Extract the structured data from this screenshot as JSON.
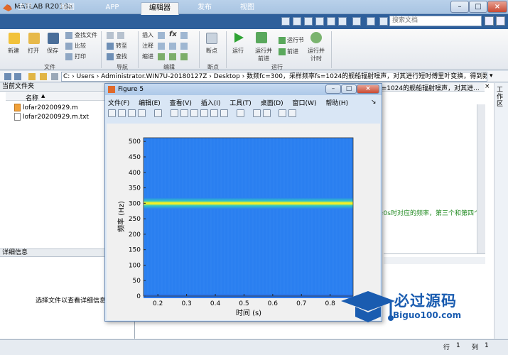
{
  "window": {
    "title": "MATLAB R2018a",
    "min": "–",
    "max": "□",
    "close": "×"
  },
  "tabs": [
    {
      "label": "主页"
    },
    {
      "label": "绘图"
    },
    {
      "label": "APP"
    },
    {
      "label": "编辑器"
    },
    {
      "label": "发布"
    },
    {
      "label": "视图"
    }
  ],
  "search": {
    "placeholder": "搜索文档"
  },
  "ribbon": {
    "file": {
      "new": "新建",
      "open": "打开",
      "save": "保存",
      "find_files": "查找文件",
      "compare": "比较",
      "print": "打印",
      "group": "文件"
    },
    "nav": {
      "goto": "转至",
      "find": "查找",
      "group": "导航"
    },
    "edit": {
      "insert": "插入",
      "comment": "注释",
      "indent": "缩进",
      "fx": "fx",
      "group": "编辑"
    },
    "breakpoints": {
      "label": "断点",
      "group": "断点"
    },
    "run": {
      "run": "运行",
      "run_advance": "运行并前进",
      "run_section": "运行节",
      "advance": "前进",
      "run_time": "运行并计时",
      "group": "运行"
    }
  },
  "address": {
    "path": "C: › Users › Administrator.WIN7U-20180127Z › Desktop › 数频fc=300，采样频率fs=1024的舰船辐射噪声，对其进行短时傅里叶变换，得到数频"
  },
  "current_folder": {
    "title": "当前文件夹",
    "col_name": "名称",
    "sort": "▲",
    "files": [
      "lofar20200929.m",
      "lofar20200929.m.txt"
    ]
  },
  "details": {
    "title": "详细信息",
    "empty": "选择文件以查看详细信息"
  },
  "editor": {
    "tab_text": "s=1024的舰船辐射噪声，对其进...",
    "code_line": "=0s时对应的频率，第三个和第四个"
  },
  "workspace": {
    "label": "工作区"
  },
  "figure": {
    "title": "Figure 5",
    "menu": [
      "文件(F)",
      "编辑(E)",
      "查看(V)",
      "插入(I)",
      "工具(T)",
      "桌面(D)",
      "窗口(W)",
      "帮助(H)"
    ]
  },
  "chart_data": {
    "type": "heatmap",
    "xlabel": "时间 (s)",
    "ylabel": "频率 (Hz)",
    "xticks": [
      "0.2",
      "0.3",
      "0.4",
      "0.5",
      "0.6",
      "0.7",
      "0.8"
    ],
    "yticks": [
      "0",
      "50",
      "100",
      "150",
      "200",
      "250",
      "300",
      "350",
      "400",
      "450",
      "500"
    ],
    "xlim": [
      0.15,
      0.88
    ],
    "ylim": [
      0,
      512
    ],
    "bands": [
      {
        "freq": 300,
        "intensity": "high",
        "color": "#f5f123"
      },
      {
        "freq": 0,
        "intensity": "low",
        "color": "#2b78ee"
      }
    ],
    "background_color": "#2a7ff0"
  },
  "status": {
    "row_label": "行",
    "row": "1",
    "col_label": "列",
    "col": "1"
  },
  "watermark": {
    "main": "必过源码",
    "sub": "Biguo100.com"
  }
}
